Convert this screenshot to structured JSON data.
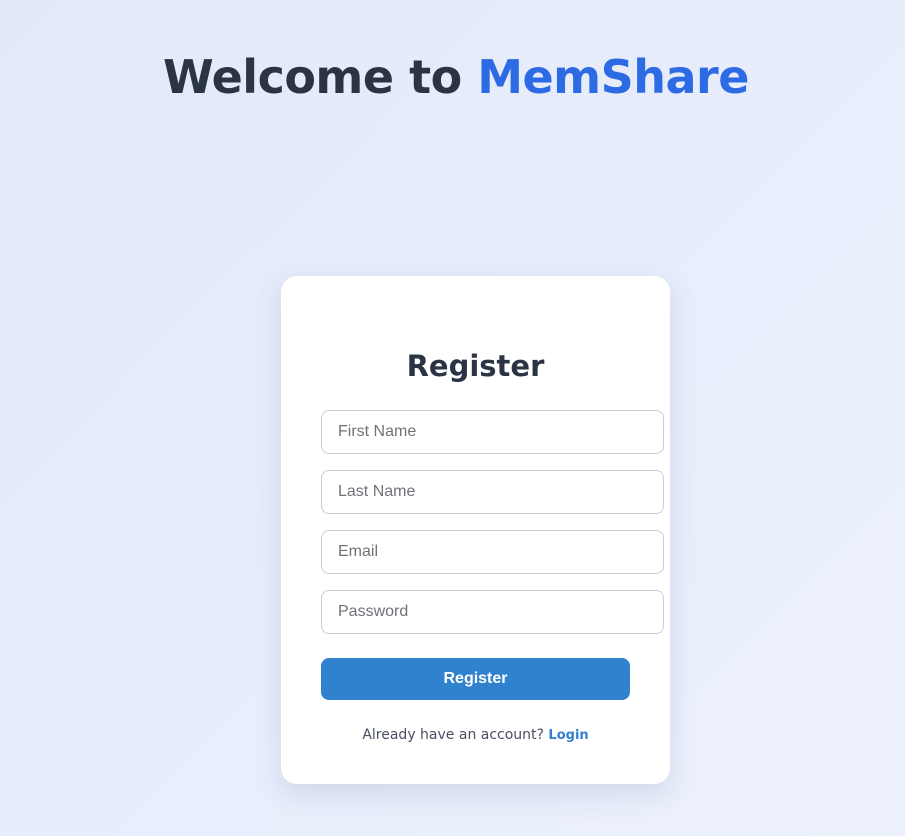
{
  "header": {
    "welcome_text": "Welcome to ",
    "brand": "MemShare"
  },
  "form": {
    "title": "Register",
    "fields": [
      {
        "placeholder": "First Name",
        "value": ""
      },
      {
        "placeholder": "Last Name",
        "value": ""
      },
      {
        "placeholder": "Email",
        "value": ""
      },
      {
        "placeholder": "Password",
        "value": ""
      }
    ],
    "submit_label": "Register",
    "footer_text": "Already have an account?",
    "login_link": "Login"
  },
  "colors": {
    "brand": "#2d6be4",
    "primary_button": "#3182ce",
    "heading": "#2b3445"
  }
}
